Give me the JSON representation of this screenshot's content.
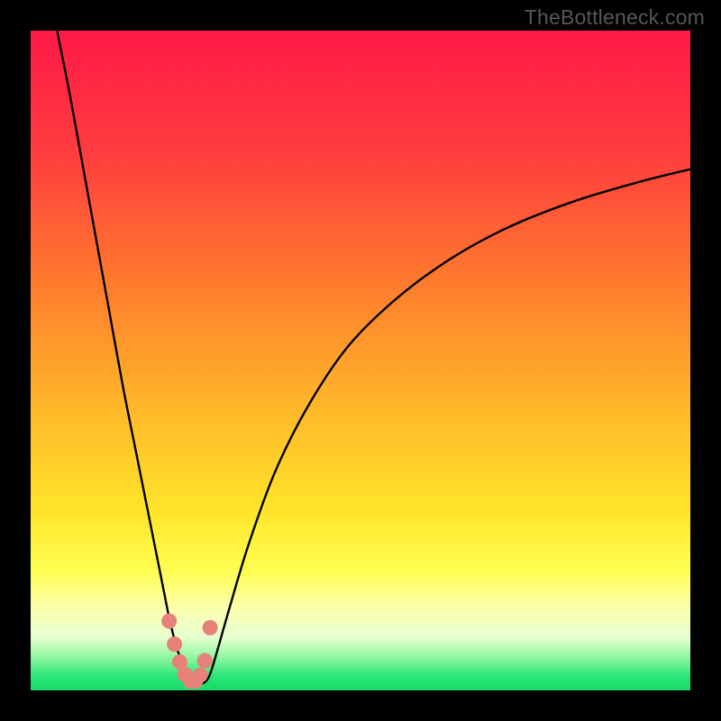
{
  "watermark": "TheBottleneck.com",
  "colors": {
    "frame": "#000000",
    "gradient_stops": [
      {
        "pct": 0,
        "color": "#ff1a47"
      },
      {
        "pct": 18,
        "color": "#ff3b3f"
      },
      {
        "pct": 38,
        "color": "#ff7a2d"
      },
      {
        "pct": 58,
        "color": "#ffba29"
      },
      {
        "pct": 73,
        "color": "#ffe52a"
      },
      {
        "pct": 82,
        "color": "#ffff53"
      },
      {
        "pct": 88,
        "color": "#fbffb3"
      },
      {
        "pct": 92,
        "color": "#e6ffcf"
      },
      {
        "pct": 95,
        "color": "#8ef7a0"
      },
      {
        "pct": 98,
        "color": "#29e577"
      },
      {
        "pct": 100,
        "color": "#18db67"
      }
    ],
    "curve_stroke": "#000000",
    "marker_fill": "#e7817a",
    "marker_stroke": "#c25a52"
  },
  "chart_data": {
    "type": "line",
    "title": "",
    "xlabel": "",
    "ylabel": "",
    "xlim": [
      0,
      100
    ],
    "ylim": [
      0,
      100
    ],
    "series": [
      {
        "name": "bottleneck-curve",
        "x": [
          4,
          6,
          8,
          10,
          12,
          14,
          16,
          18,
          20,
          21,
          22,
          23,
          24,
          25,
          26,
          27,
          28,
          30,
          33,
          37,
          42,
          48,
          55,
          63,
          72,
          82,
          92,
          100
        ],
        "y": [
          100,
          90,
          79,
          68,
          57,
          46,
          36,
          26,
          16,
          11,
          7,
          4,
          2,
          1,
          1,
          2,
          5,
          12,
          22,
          33,
          43,
          52,
          59,
          65,
          70,
          74,
          77,
          79
        ]
      }
    ],
    "markers": {
      "name": "highlight-points",
      "x": [
        21.0,
        21.8,
        22.6,
        23.4,
        24.2,
        25.0,
        25.7,
        26.4,
        27.2
      ],
      "y": [
        10.5,
        7.0,
        4.3,
        2.4,
        1.4,
        1.4,
        2.3,
        4.5,
        9.5
      ]
    }
  }
}
